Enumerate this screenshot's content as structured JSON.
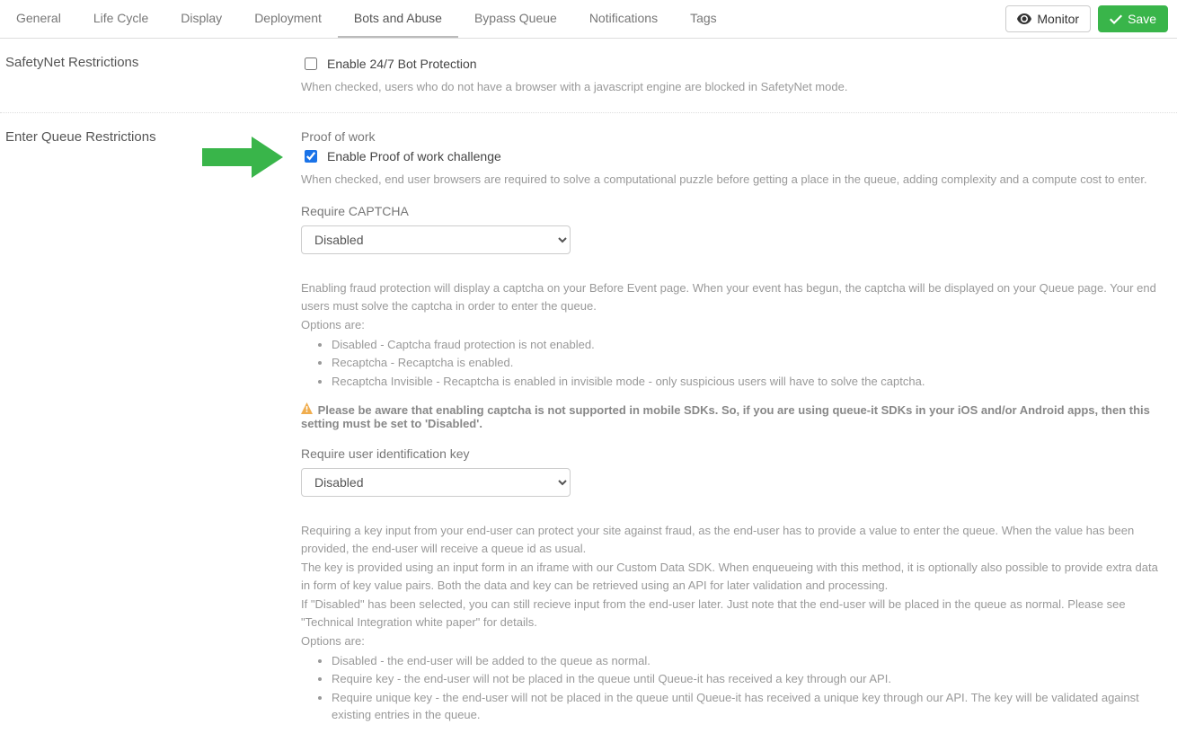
{
  "tabs": {
    "general": "General",
    "lifecycle": "Life Cycle",
    "display": "Display",
    "deployment": "Deployment",
    "bots": "Bots and Abuse",
    "bypass": "Bypass Queue",
    "notifications": "Notifications",
    "tags": "Tags"
  },
  "actions": {
    "monitor": "Monitor",
    "save": "Save"
  },
  "safetynet": {
    "section": "SafetyNet Restrictions",
    "checkbox": "Enable 24/7 Bot Protection",
    "help": "When checked, users who do not have a browser with a javascript engine are blocked in SafetyNet mode."
  },
  "enterqueue": {
    "section": "Enter Queue Restrictions",
    "pow_title": "Proof of work",
    "pow_checkbox": "Enable Proof of work challenge",
    "pow_help": "When checked, end user browsers are required to solve a computational puzzle before getting a place in the queue, adding complexity and a compute cost to enter.",
    "captcha_title": "Require CAPTCHA",
    "captcha_value": "Disabled",
    "captcha_help_p1": "Enabling fraud protection will display a captcha on your Before Event page. When your event has begun, the captcha will be displayed on your Queue page. Your end users must solve the captcha in order to enter the queue.",
    "captcha_help_opts_label": "Options are:",
    "captcha_opt1": "Disabled - Captcha fraud protection is not enabled.",
    "captcha_opt2": "Recaptcha - Recaptcha is enabled.",
    "captcha_opt3": "Recaptcha Invisible - Recaptcha is enabled in invisible mode - only suspicious users will have to solve the captcha.",
    "captcha_warn": "Please be aware that enabling captcha is not supported in mobile SDKs. So, if you are using queue-it SDKs in your iOS and/or Android apps, then this setting must be set to 'Disabled'.",
    "uid_title": "Require user identification key",
    "uid_value": "Disabled",
    "uid_help_p1": "Requiring a key input from your end-user can protect your site against fraud, as the end-user has to provide a value to enter the queue. When the value has been provided, the end-user will receive a queue id as usual.",
    "uid_help_p2": "The key is provided using an input form in an iframe with our Custom Data SDK. When enqueueing with this method, it is optionally also possible to provide extra data in form of key value pairs. Both the data and key can be retrieved using an API for later validation and processing.",
    "uid_help_p3": "If \"Disabled\" has been selected, you can still recieve input from the end-user later. Just note that the end-user will be placed in the queue as normal. Please see \"Technical Integration white paper\" for details.",
    "uid_help_opts_label": "Options are:",
    "uid_opt1": "Disabled - the end-user will be added to the queue as normal.",
    "uid_opt2": "Require key - the end-user will not be placed in the queue until Queue-it has received a key through our API.",
    "uid_opt3": "Require unique key - the end-user will not be placed in the queue until Queue-it has received a unique key through our API. The key will be validated against existing entries in the queue."
  }
}
